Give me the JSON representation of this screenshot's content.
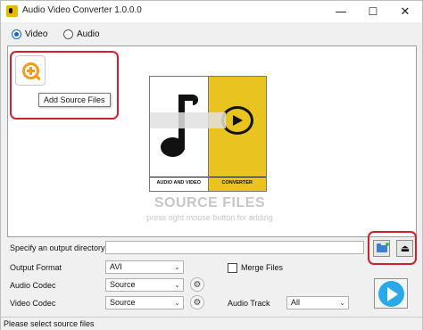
{
  "window": {
    "title": "Audio Video Converter 1.0.0.0",
    "minimize": "—",
    "maximize": "☐",
    "close": "✕"
  },
  "mode": {
    "options": [
      "Video",
      "Audio"
    ],
    "selected": "Video"
  },
  "source_panel": {
    "tooltip": "Add Source Files",
    "logo_caption_left": "AUDIO AND VIDEO",
    "logo_caption_right": "CONVERTER",
    "placeholder_title": "SOURCE FILES",
    "placeholder_hint": "press right mouse button for adding"
  },
  "form": {
    "output_dir_label": "Specify an output directory",
    "output_dir_value": "",
    "output_format_label": "Output Format",
    "output_format_value": "AVI",
    "merge_files_label": "Merge Files",
    "merge_files_checked": false,
    "audio_codec_label": "Audio Codec",
    "audio_codec_value": "Source",
    "video_codec_label": "Video Codec",
    "video_codec_value": "Source",
    "audio_track_label": "Audio Track",
    "audio_track_value": "All"
  },
  "icons": {
    "add_files": "add-files-icon",
    "browse_folder": "folder-icon",
    "open_folder": "open-folder-icon",
    "settings": "gear-icon",
    "convert": "play-icon"
  },
  "colors": {
    "accent_orange": "#f29b1e",
    "highlight_red": "#d11f2e",
    "logo_yellow": "#e9c320",
    "convert_blue": "#29a9e8",
    "radio_blue": "#1566c0"
  },
  "status": {
    "text": "Please select source files"
  }
}
